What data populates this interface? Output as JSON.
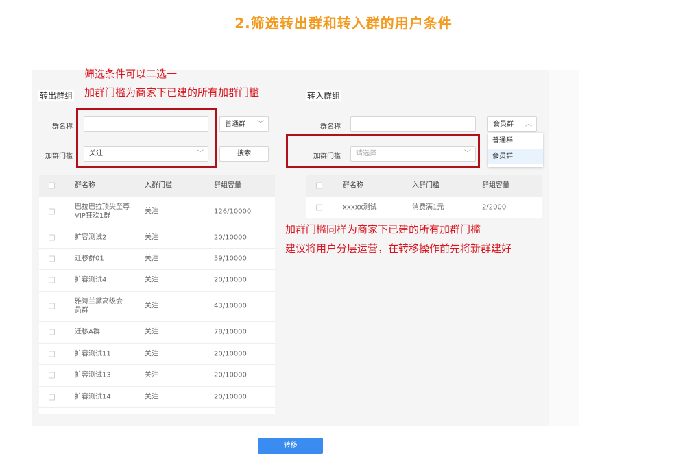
{
  "title": "2.筛选转出群和转入群的用户条件",
  "out_group": {
    "heading": "转出群组",
    "name_label": "群名称",
    "name_value": "",
    "type_select": "普通群",
    "threshold_label": "加群门槛",
    "threshold_value": "关注",
    "search_label": "搜索",
    "columns": [
      "群名称",
      "入群门槛",
      "群组容量"
    ],
    "rows": [
      {
        "name": "巴拉巴拉顶尖至尊VIP狂欢1群",
        "threshold": "关注",
        "capacity": "126/10000"
      },
      {
        "name": "扩容测试2",
        "threshold": "关注",
        "capacity": "20/10000"
      },
      {
        "name": "迁移群01",
        "threshold": "关注",
        "capacity": "59/10000"
      },
      {
        "name": "扩容测试4",
        "threshold": "关注",
        "capacity": "20/10000"
      },
      {
        "name": "雅诗兰黛高级会员群",
        "threshold": "关注",
        "capacity": "43/10000"
      },
      {
        "name": "迁移A群",
        "threshold": "关注",
        "capacity": "78/10000"
      },
      {
        "name": "扩容测试11",
        "threshold": "关注",
        "capacity": "20/10000"
      },
      {
        "name": "扩容测试13",
        "threshold": "关注",
        "capacity": "20/10000"
      },
      {
        "name": "扩容测试14",
        "threshold": "关注",
        "capacity": "20/10000"
      }
    ]
  },
  "in_group": {
    "heading": "转入群组",
    "name_label": "群名称",
    "name_value": "",
    "type_select": "会员群",
    "type_options": [
      "普通群",
      "会员群"
    ],
    "threshold_label": "加群门槛",
    "threshold_placeholder": "请选择",
    "columns": [
      "群名称",
      "入群门槛",
      "群组容量"
    ],
    "rows": [
      {
        "name": "xxxxx测试",
        "threshold": "消费满1元",
        "capacity": "2/2000"
      }
    ]
  },
  "annotations": {
    "left_line1": "筛选条件可以二选一",
    "left_line2": "加群门槛为商家下已建的所有加群门槛",
    "right_line1": "加群门槛同样为商家下已建的所有加群门槛",
    "right_line2": "建议将用户分层运营，在转移操作前先将新群建好"
  },
  "transfer_button": "转移",
  "colors": {
    "title": "#f39a1e",
    "annotation": "#d8141e",
    "annotation_box": "#b0101a",
    "primary_button": "#3b8cf0"
  }
}
